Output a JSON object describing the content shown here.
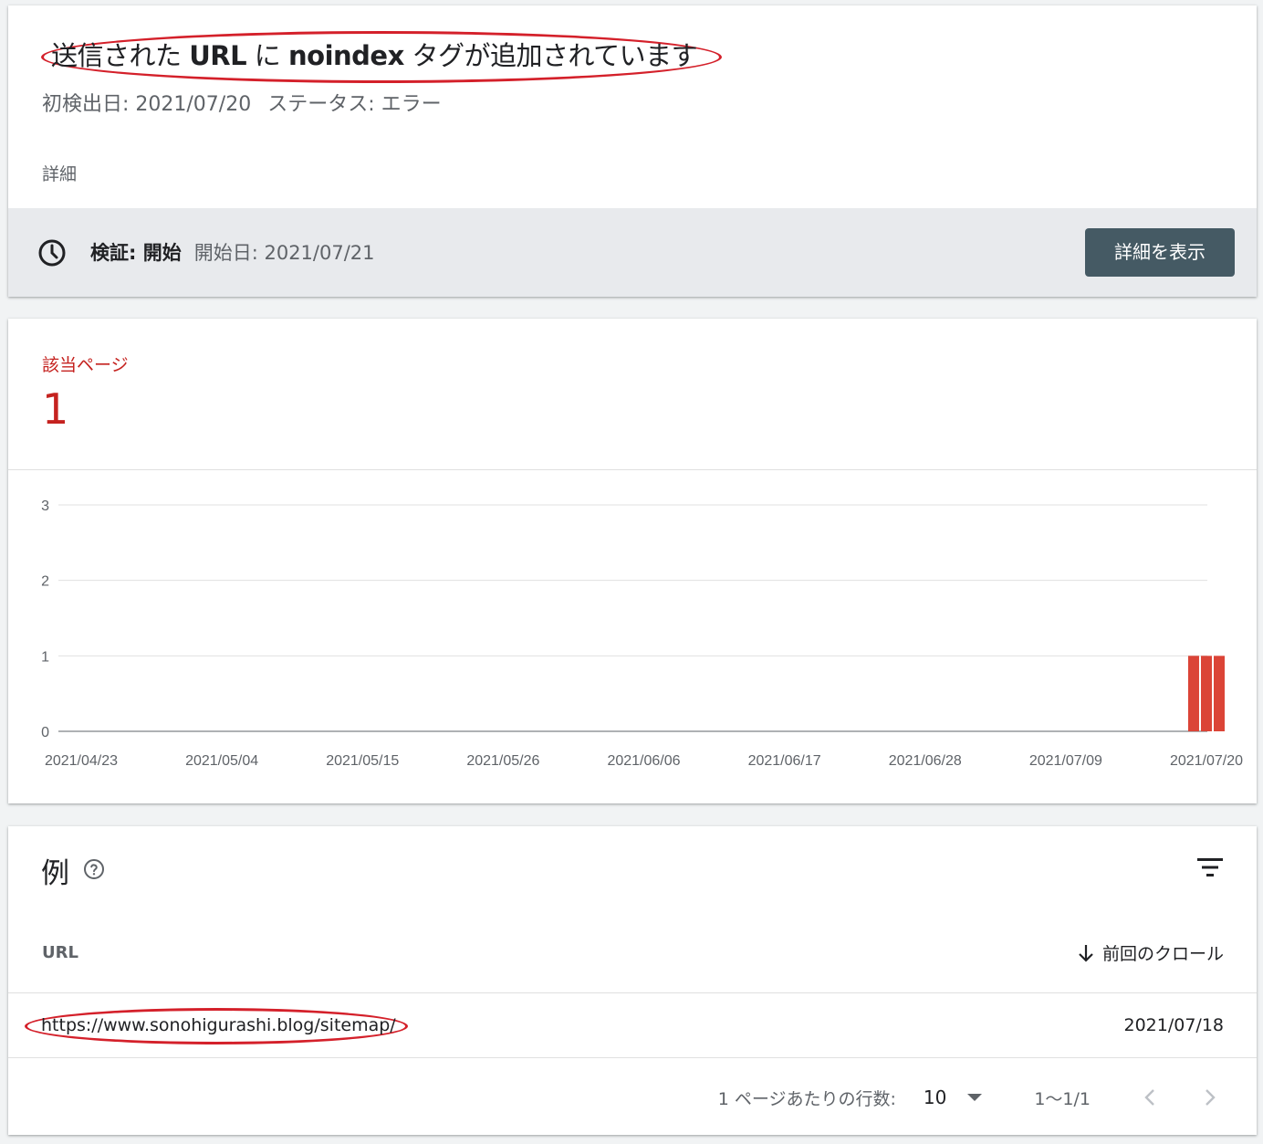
{
  "issue": {
    "title_parts": [
      "送信された ",
      "URL",
      " に ",
      "noindex",
      " タグが追加されています"
    ],
    "first_detected": "初検出日: 2021/07/20",
    "status": "ステータス: エラー",
    "details_label": "詳細",
    "validation_label": "検証: 開始",
    "validation_start": "開始日: 2021/07/21",
    "show_details_button": "詳細を表示"
  },
  "metric": {
    "label": "該当ページ",
    "value": "1"
  },
  "chart_data": {
    "type": "bar",
    "x_tick_labels": [
      "2021/04/23",
      "2021/05/04",
      "2021/05/15",
      "2021/05/26",
      "2021/06/06",
      "2021/06/17",
      "2021/06/28",
      "2021/07/09",
      "2021/07/20"
    ],
    "x_range": [
      "2021/04/23",
      "2021/07/21"
    ],
    "y_ticks": [
      0,
      1,
      2,
      3
    ],
    "ylim": [
      0,
      3
    ],
    "grid": true,
    "series": [
      {
        "color": "#db4437",
        "points": [
          {
            "x": "2021/07/19",
            "y": 1
          },
          {
            "x": "2021/07/20",
            "y": 1
          },
          {
            "x": "2021/07/21",
            "y": 1
          }
        ]
      }
    ]
  },
  "examples": {
    "title": "例",
    "help_icon": "help-circle-icon",
    "filter_icon": "filter-icon",
    "col_url": "URL",
    "col_last_crawl": "前回のクロール",
    "rows": [
      {
        "url": "https://www.sonohigurashi.blog/sitemap/",
        "last_crawl": "2021/07/18"
      }
    ],
    "pager": {
      "rows_per_page_label": "1 ページあたりの行数:",
      "rows_per_page_value": "10",
      "range": "1～1/1"
    }
  },
  "colors": {
    "error_red": "#c5221f",
    "bar_red": "#db4437",
    "button_bg": "#455a64",
    "annotation_red": "#d4202a"
  }
}
